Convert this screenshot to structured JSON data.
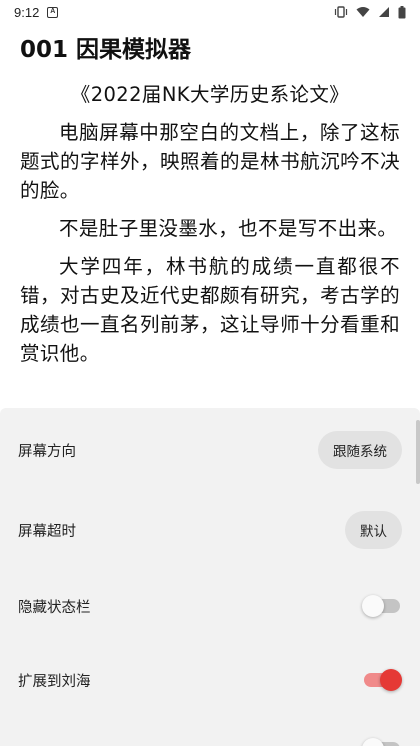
{
  "status_bar": {
    "time": "9:12",
    "notification_glyph": "A",
    "icons": [
      "vibrate-icon",
      "wifi-icon",
      "cell-signal-icon",
      "battery-icon"
    ]
  },
  "reader": {
    "chapter_title": "001 因果模拟器",
    "paragraphs": [
      "《2022届NK大学历史系论文》",
      "电脑屏幕中那空白的文档上，除了这标题式的字样外，映照着的是林书航沉吟不决的脸。",
      "不是肚子里没墨水，也不是写不出来。",
      "大学四年，林书航的成绩一直都很不错，对古史及近代史都颇有研究，考古学的成绩也一直名列前茅，这让导师十分看重和赏识他。"
    ]
  },
  "settings": {
    "screen_orientation": {
      "label": "屏幕方向",
      "value": "跟随系统"
    },
    "screen_timeout": {
      "label": "屏幕超时",
      "value": "默认"
    },
    "hide_status_bar": {
      "label": "隐藏状态栏",
      "enabled": false
    },
    "extend_to_notch": {
      "label": "扩展到刘海",
      "enabled": true
    }
  },
  "colors": {
    "accent": "#e53935",
    "accent_track": "#f08a8a",
    "panel_bg": "#f2f2f2",
    "pill_bg": "#e2e2e2"
  }
}
